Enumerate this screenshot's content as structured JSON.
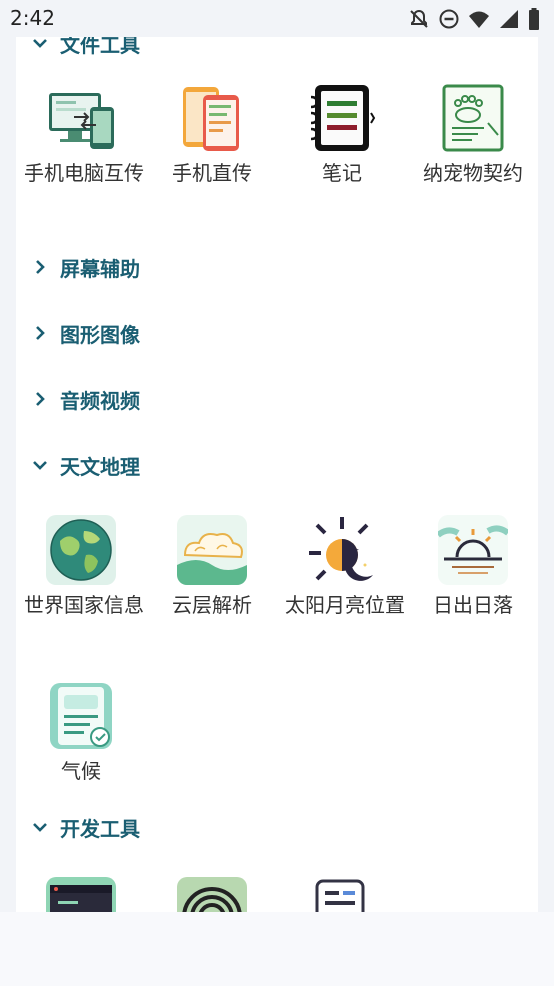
{
  "status": {
    "time": "2:42"
  },
  "sections": {
    "file_tools": "文件工具",
    "screen_assist": "屏幕辅助",
    "graphics": "图形图像",
    "audio_video": "音频视频",
    "astro_geo": "天文地理",
    "dev_tools": "开发工具"
  },
  "apps": {
    "phone_pc": "手机电脑互传",
    "phone_direct": "手机直传",
    "notes": "笔记",
    "pet_contract": "纳宠物契约",
    "world_info": "世界国家信息",
    "cloud": "云层解析",
    "sun_moon": "太阳月亮位置",
    "sunrise": "日出日落",
    "climate": "气候"
  }
}
